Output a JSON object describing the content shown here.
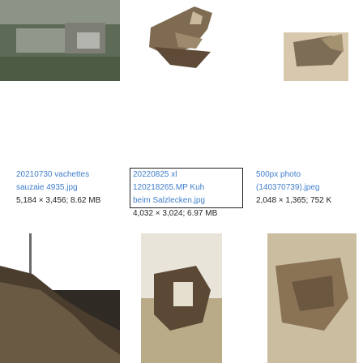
{
  "items": [
    {
      "name_lines": [
        "20210730 vachettes",
        "sauzaie 4935.jpg"
      ],
      "meta": "5,184 × 3,456; 8.62 MB",
      "selected": false
    },
    {
      "name_lines": [
        "20220825 xl",
        "120218265.MP Kuh",
        "beim Salzlecken.jpg"
      ],
      "meta": "4,032 × 3,024; 6.97 MB",
      "selected": true
    },
    {
      "name_lines": [
        "500px photo",
        "(140370739).jpeg"
      ],
      "meta": "2,048 × 1,365; 752 K",
      "selected": false
    }
  ],
  "colors": {
    "link": "#3f7ecb",
    "text": "#222222",
    "selection_border": "#222222"
  }
}
